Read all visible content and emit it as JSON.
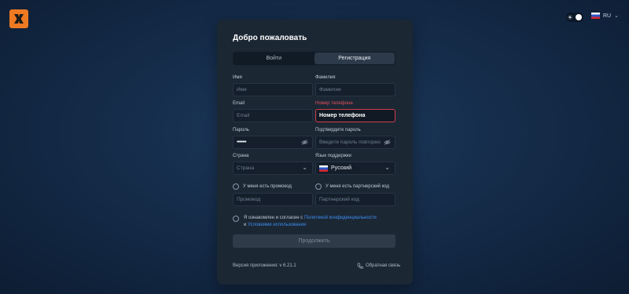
{
  "header": {
    "logo_icon": "x-logo-icon",
    "theme_icons": [
      "sun-icon",
      "moon-icon"
    ],
    "language": {
      "code": "RU",
      "flag": "ru-flag"
    }
  },
  "card": {
    "title": "Добро пожаловать",
    "tabs": [
      {
        "label": "Войти",
        "active": false
      },
      {
        "label": "Регистрация",
        "active": true
      }
    ],
    "fields": {
      "first_name": {
        "label": "Имя",
        "placeholder": "Имя",
        "value": ""
      },
      "last_name": {
        "label": "Фамилия",
        "placeholder": "Фамилия",
        "value": ""
      },
      "email": {
        "label": "Email",
        "placeholder": "Email",
        "value": ""
      },
      "phone": {
        "label": "Номер телефона",
        "value": "Номер телефона",
        "error": true
      },
      "password": {
        "label": "Пароль",
        "value": "••••••••"
      },
      "password_confirm": {
        "label": "Подтвердите пароль",
        "placeholder": "Введите пароль повторно"
      },
      "country": {
        "label": "Страна",
        "placeholder": "Страна"
      },
      "support_lang": {
        "label": "Язык поддержки",
        "value": "Русский"
      },
      "promo_check": {
        "label": "У меня есть промокод"
      },
      "partner_check": {
        "label": "У меня есть партнерский код"
      },
      "promo": {
        "placeholder": "Промокод"
      },
      "partner": {
        "placeholder": "Партнерский код"
      }
    },
    "agreement": {
      "prefix": "Я ознакомлен и согласен с",
      "privacy_link": "Политикой конфиденциальности",
      "and": "и",
      "terms_link": "Условиями использования"
    },
    "continue_label": "Продолжить",
    "version": "Версия приложения: v 6.21.1",
    "feedback": "Обратная связь"
  },
  "colors": {
    "accent": "#ee7a22",
    "error": "#e2515f",
    "link": "#3c8ff0",
    "card_bg": "#1c2734"
  }
}
